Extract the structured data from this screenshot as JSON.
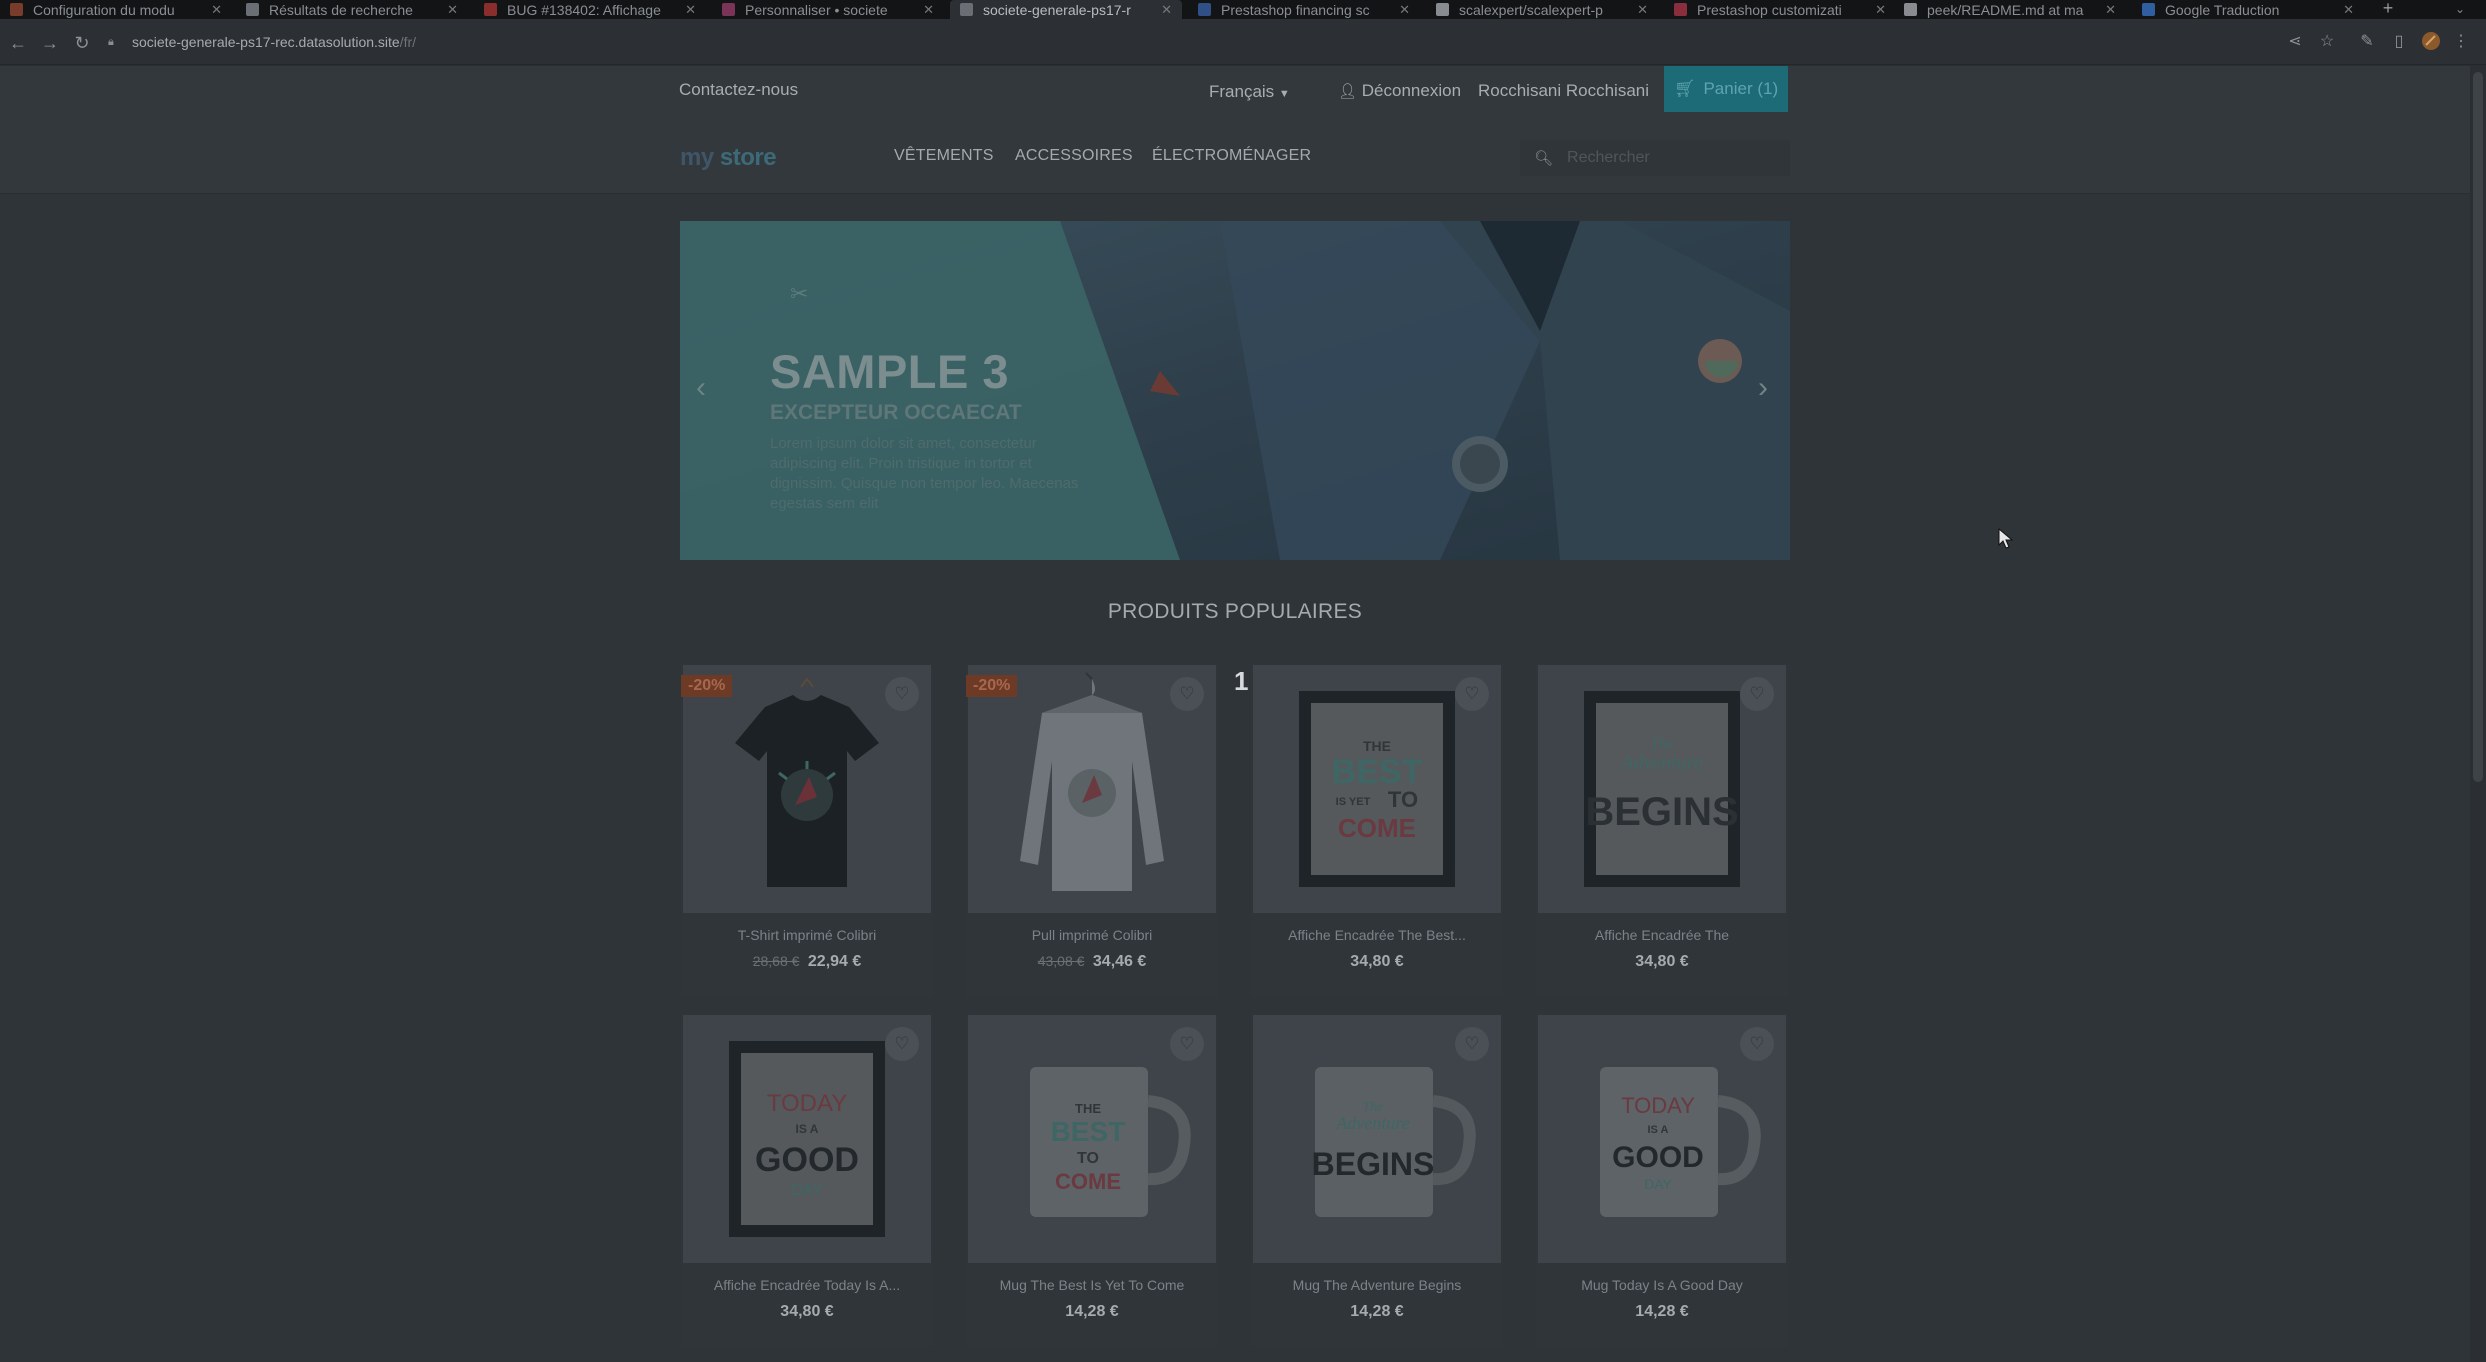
{
  "browser": {
    "tabs": [
      {
        "title": "Configuration du modu",
        "favicon_color": "#7a3c2a",
        "active": false
      },
      {
        "title": "Résultats de recherche",
        "favicon_color": "#6a6f75",
        "active": false
      },
      {
        "title": "BUG #138402: Affichage",
        "favicon_color": "#8a2d2d",
        "active": false
      },
      {
        "title": "Personnaliser • societe",
        "favicon_color": "#7a3458",
        "active": false
      },
      {
        "title": "societe-generale-ps17-r",
        "favicon_color": "#6a6f75",
        "active": true
      },
      {
        "title": "Prestashop financing sc",
        "favicon_color": "#2f4f86",
        "active": false
      },
      {
        "title": "scalexpert/scalexpert-p",
        "favicon_color": "#888c90",
        "active": false
      },
      {
        "title": "Prestashop customizati",
        "favicon_color": "#8a2d3c",
        "active": false
      },
      {
        "title": "peek/README.md at ma",
        "favicon_color": "#888c90",
        "active": false
      },
      {
        "title": "Google Traduction",
        "favicon_color": "#2f5fa0",
        "active": false
      }
    ],
    "url_host": "societe-generale-ps17-rec.datasolution.site",
    "url_path": "/fr/"
  },
  "header": {
    "contact": "Contactez-nous",
    "language": "Français",
    "logout": "Déconnexion",
    "user_name": "Rocchisani Rocchisani",
    "cart_label": "Panier (1)"
  },
  "logo": {
    "part1": "my",
    "part2": "store"
  },
  "menu": [
    "VÊTEMENTS",
    "ACCESSOIRES",
    "ÉLECTROMÉNAGER"
  ],
  "search": {
    "placeholder": "Rechercher"
  },
  "carousel": {
    "title": "SAMPLE 3",
    "subtitle": "EXCEPTEUR OCCAECAT",
    "text": "Lorem ipsum dolor sit amet, consectetur adipiscing elit. Proin tristique in tortor et dignissim. Quisque non tempor leo. Maecenas egestas sem elit"
  },
  "popular": {
    "title": "PRODUITS POPULAIRES",
    "marker": "1"
  },
  "products": [
    {
      "name": "T-Shirt imprimé Colibri",
      "old_price": "28,68 €",
      "price": "22,94 €",
      "badge": "-20%",
      "wishlist": "♡"
    },
    {
      "name": "Pull imprimé Colibri",
      "old_price": "43,08 €",
      "price": "34,46 €",
      "badge": "-20%",
      "wishlist": "♡"
    },
    {
      "name": "Affiche Encadrée The Best...",
      "old_price": "",
      "price": "34,80 €",
      "badge": "",
      "wishlist": "♡"
    },
    {
      "name": "Affiche Encadrée The",
      "old_price": "",
      "price": "34,80 €",
      "badge": "",
      "wishlist": "♡"
    },
    {
      "name": "Affiche Encadrée Today Is A...",
      "old_price": "",
      "price": "34,80 €",
      "badge": "",
      "wishlist": "♡"
    },
    {
      "name": "Mug The Best Is Yet To Come",
      "old_price": "",
      "price": "14,28 €",
      "badge": "",
      "wishlist": "♡"
    },
    {
      "name": "Mug The Adventure Begins",
      "old_price": "",
      "price": "14,28 €",
      "badge": "",
      "wishlist": "♡"
    },
    {
      "name": "Mug Today Is A Good Day",
      "old_price": "",
      "price": "14,28 €",
      "badge": "",
      "wishlist": "♡"
    }
  ],
  "artwork": {
    "best": [
      "THE",
      "BEST",
      "IS YET",
      "TO",
      "COME"
    ],
    "adventure": [
      "The",
      "Adventure",
      "BEGINS"
    ],
    "today": [
      "TODAY",
      "IS A",
      "GOOD",
      "DAY"
    ]
  }
}
